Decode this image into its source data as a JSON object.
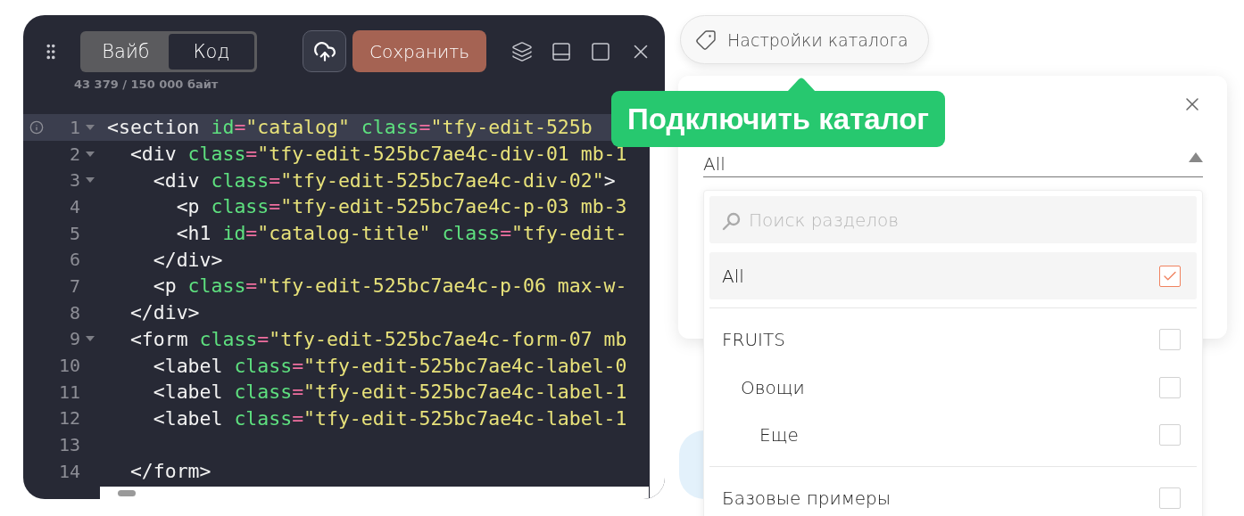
{
  "editor": {
    "mode_tabs": [
      {
        "label": "Вайб",
        "selected": false
      },
      {
        "label": "Код",
        "selected": true
      }
    ],
    "save_button": "Сохранить",
    "byte_count": "43 379 / 150 000 байт",
    "lines": [
      {
        "number": "1",
        "foldable": true,
        "active": true,
        "tokens": [
          {
            "kind": "tag",
            "text": "<section"
          },
          {
            "kind": "attr",
            "text": " id"
          },
          {
            "kind": "eq",
            "text": "="
          },
          {
            "kind": "str",
            "text": "\"catalog\""
          },
          {
            "kind": "attr",
            "text": " class"
          },
          {
            "kind": "eq",
            "text": "="
          },
          {
            "kind": "str",
            "text": "\"tfy-edit-525b"
          }
        ]
      },
      {
        "number": "2",
        "foldable": true,
        "active": false,
        "tokens": [
          {
            "kind": "tag",
            "text": "  <div"
          },
          {
            "kind": "attr",
            "text": " class"
          },
          {
            "kind": "eq",
            "text": "="
          },
          {
            "kind": "str",
            "text": "\"tfy-edit-525bc7ae4c-div-01 mb-1"
          }
        ]
      },
      {
        "number": "3",
        "foldable": true,
        "active": false,
        "tokens": [
          {
            "kind": "tag",
            "text": "    <div"
          },
          {
            "kind": "attr",
            "text": " class"
          },
          {
            "kind": "eq",
            "text": "="
          },
          {
            "kind": "str",
            "text": "\"tfy-edit-525bc7ae4c-div-02\""
          },
          {
            "kind": "tag",
            "text": ">"
          }
        ]
      },
      {
        "number": "4",
        "foldable": false,
        "active": false,
        "tokens": [
          {
            "kind": "tag",
            "text": "      <p"
          },
          {
            "kind": "attr",
            "text": " class"
          },
          {
            "kind": "eq",
            "text": "="
          },
          {
            "kind": "str",
            "text": "\"tfy-edit-525bc7ae4c-p-03 mb-3"
          }
        ]
      },
      {
        "number": "5",
        "foldable": false,
        "active": false,
        "tokens": [
          {
            "kind": "tag",
            "text": "      <h1"
          },
          {
            "kind": "attr",
            "text": " id"
          },
          {
            "kind": "eq",
            "text": "="
          },
          {
            "kind": "str",
            "text": "\"catalog-title\""
          },
          {
            "kind": "attr",
            "text": " class"
          },
          {
            "kind": "eq",
            "text": "="
          },
          {
            "kind": "str",
            "text": "\"tfy-edit-"
          }
        ]
      },
      {
        "number": "6",
        "foldable": false,
        "active": false,
        "tokens": [
          {
            "kind": "tag",
            "text": "    </div>"
          }
        ]
      },
      {
        "number": "7",
        "foldable": false,
        "active": false,
        "tokens": [
          {
            "kind": "tag",
            "text": "    <p"
          },
          {
            "kind": "attr",
            "text": " class"
          },
          {
            "kind": "eq",
            "text": "="
          },
          {
            "kind": "str",
            "text": "\"tfy-edit-525bc7ae4c-p-06 max-w-"
          }
        ]
      },
      {
        "number": "8",
        "foldable": false,
        "active": false,
        "tokens": [
          {
            "kind": "tag",
            "text": "  </div>"
          }
        ]
      },
      {
        "number": "9",
        "foldable": true,
        "active": false,
        "tokens": [
          {
            "kind": "tag",
            "text": "  <form"
          },
          {
            "kind": "attr",
            "text": " class"
          },
          {
            "kind": "eq",
            "text": "="
          },
          {
            "kind": "str",
            "text": "\"tfy-edit-525bc7ae4c-form-07 mb"
          }
        ]
      },
      {
        "number": "10",
        "foldable": false,
        "active": false,
        "tokens": [
          {
            "kind": "tag",
            "text": "    <label"
          },
          {
            "kind": "attr",
            "text": " class"
          },
          {
            "kind": "eq",
            "text": "="
          },
          {
            "kind": "str",
            "text": "\"tfy-edit-525bc7ae4c-label-0"
          }
        ]
      },
      {
        "number": "11",
        "foldable": false,
        "active": false,
        "tokens": [
          {
            "kind": "tag",
            "text": "    <label"
          },
          {
            "kind": "attr",
            "text": " class"
          },
          {
            "kind": "eq",
            "text": "="
          },
          {
            "kind": "str",
            "text": "\"tfy-edit-525bc7ae4c-label-1"
          }
        ]
      },
      {
        "number": "12",
        "foldable": false,
        "active": false,
        "tokens": [
          {
            "kind": "tag",
            "text": "    <label"
          },
          {
            "kind": "attr",
            "text": " class"
          },
          {
            "kind": "eq",
            "text": "="
          },
          {
            "kind": "str",
            "text": "\"tfy-edit-525bc7ae4c-label-1"
          }
        ]
      },
      {
        "number": "13",
        "foldable": false,
        "active": false
      },
      {
        "number": "14",
        "foldable": false,
        "active": false,
        "tokens": [
          {
            "kind": "tag",
            "text": "  </form>"
          }
        ]
      }
    ]
  },
  "catalog_button": "Настройки каталога",
  "tooltip": "Подключить каталог",
  "catalog_select": {
    "value": "All",
    "expanded": true
  },
  "dropdown": {
    "search": {
      "placeholder": "Поиск разделов"
    },
    "groups": [
      {
        "options": [
          {
            "label": "All",
            "checked": true,
            "selected": true
          }
        ]
      },
      {
        "options": [
          {
            "label": "FRUITS",
            "checked": false,
            "selected": false,
            "children": [
              {
                "label": "Овощи",
                "checked": false,
                "selected": false,
                "children": [
                  {
                    "label": "Еще",
                    "checked": false,
                    "selected": false
                  }
                ]
              }
            ]
          }
        ]
      },
      {
        "options": [
          {
            "label": "Базовые примеры",
            "checked": false,
            "selected": false
          }
        ]
      }
    ]
  }
}
